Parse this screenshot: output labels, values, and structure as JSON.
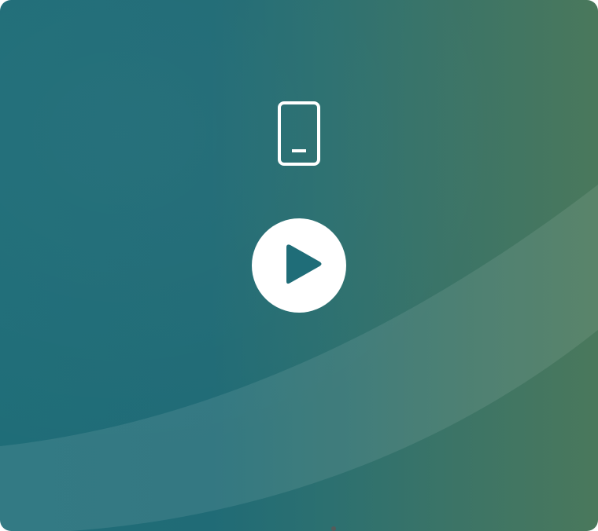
{
  "media_card": {
    "background_colors": [
      "#1f6d78",
      "#2c7070",
      "#4a785c"
    ],
    "icon": "smartphone-icon",
    "play_icon": "play-icon",
    "play_button_color": "#ffffff",
    "play_glyph_color": "#1f6d78"
  }
}
